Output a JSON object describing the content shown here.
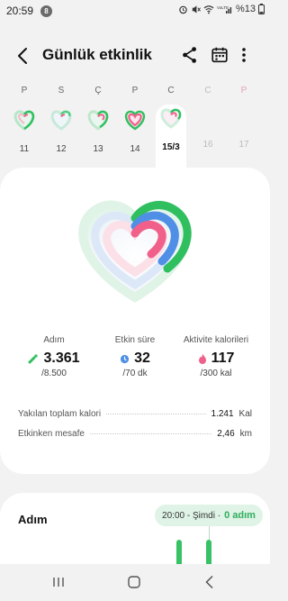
{
  "status": {
    "time": "20:59",
    "notif_badge": "8",
    "battery": "%13"
  },
  "header": {
    "title": "Günlük etkinlik"
  },
  "week": [
    {
      "name": "P",
      "date": "11",
      "state": "past"
    },
    {
      "name": "S",
      "date": "12",
      "state": "past"
    },
    {
      "name": "Ç",
      "date": "13",
      "state": "past"
    },
    {
      "name": "P",
      "date": "14",
      "state": "past"
    },
    {
      "name": "C",
      "date": "15/3",
      "state": "selected"
    },
    {
      "name": "C",
      "date": "16",
      "state": "future"
    },
    {
      "name": "P",
      "date": "17",
      "state": "future-sunday"
    }
  ],
  "metrics": {
    "steps": {
      "label": "Adım",
      "value": "3.361",
      "goal": "/8.500",
      "color": "#2fbf5f",
      "progress": 0.395
    },
    "active_time": {
      "label": "Etkin süre",
      "value": "32",
      "goal": "/70 dk",
      "color": "#4f8fe6",
      "progress": 0.457
    },
    "calories": {
      "label": "Aktivite kalorileri",
      "value": "117",
      "goal": "/300 kal",
      "color": "#f0608a",
      "progress": 0.39
    }
  },
  "summary": {
    "total_cal_label": "Yakılan toplam kalori",
    "total_cal_value": "1.241",
    "total_cal_unit": "Kal",
    "distance_label": "Etkinken mesafe",
    "distance_value": "2,46",
    "distance_unit": "km"
  },
  "step_card": {
    "title": "Adım",
    "tooltip_time": "20:00 - Şimdi ·",
    "tooltip_value": "0 adım"
  },
  "colors": {
    "steps": "#2fbf5f",
    "active": "#4f8fe6",
    "calories": "#f0608a"
  }
}
